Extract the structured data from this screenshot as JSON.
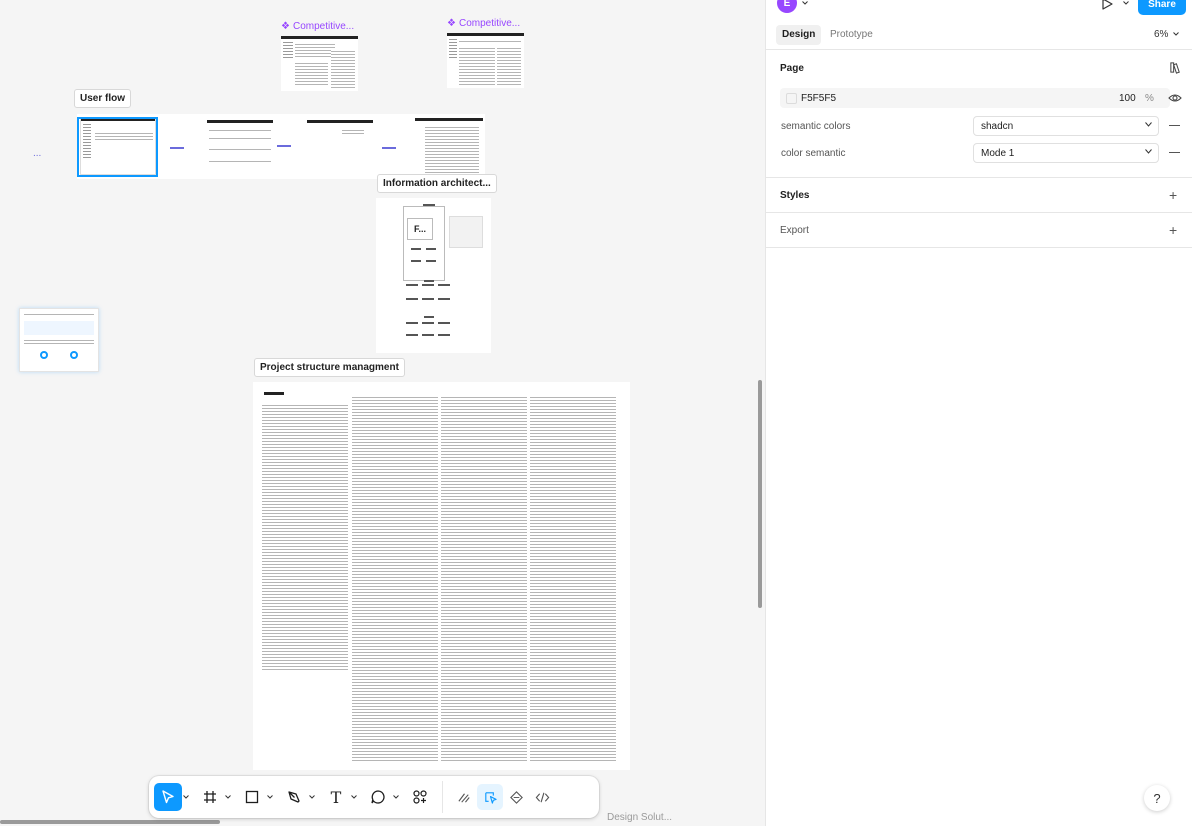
{
  "canvas": {
    "component_labels": [
      {
        "id": "comp-1",
        "text": "Competitive..."
      },
      {
        "id": "comp-2",
        "text": "Competitive..."
      }
    ],
    "frame_labels": {
      "user_flow": "User flow",
      "information_architecture": "Information architect...",
      "project_structure": "Project structure managment"
    },
    "node_text": "F...",
    "page_name_hint": "Design Solut...",
    "ellipsis": "..."
  },
  "toolbar": {
    "tools": [
      {
        "name": "move-tool",
        "icon": "cursor-arrow-icon",
        "active": true
      },
      {
        "name": "frame-tool",
        "icon": "hash-frame-icon",
        "active": false
      },
      {
        "name": "rectangle-tool",
        "icon": "rectangle-icon",
        "active": false
      },
      {
        "name": "pen-tool",
        "icon": "pen-icon",
        "active": false
      },
      {
        "name": "text-tool",
        "icon": "text-t-icon",
        "active": false
      },
      {
        "name": "comment-tool",
        "icon": "comment-bubble-icon",
        "active": false
      },
      {
        "name": "actions-tool",
        "icon": "actions-plus-icon",
        "active": false
      }
    ],
    "mode_tools": [
      {
        "name": "draw-mode",
        "icon": "draw-squiggle-icon",
        "active": false
      },
      {
        "name": "design-mode",
        "icon": "design-cursor-icon",
        "active": true
      },
      {
        "name": "components-mode",
        "icon": "component-diamond-icon",
        "active": false
      },
      {
        "name": "dev-mode",
        "icon": "code-brackets-icon",
        "active": false
      }
    ],
    "text_glyph": "T"
  },
  "panel": {
    "avatar_letter": "E",
    "share_label": "Share",
    "tabs": [
      {
        "label": "Design",
        "active": true
      },
      {
        "label": "Prototype",
        "active": false
      }
    ],
    "zoom": "6%",
    "page_section": {
      "title": "Page",
      "background_hex": "F5F5F5",
      "opacity": "100",
      "percent": "%"
    },
    "variables": [
      {
        "label": "semantic colors",
        "value": "shadcn"
      },
      {
        "label": "color semantic",
        "value": "Mode 1"
      }
    ],
    "styles_title": "Styles",
    "export_title": "Export",
    "help": "?"
  },
  "colors": {
    "accent": "#0d99ff",
    "component": "#9747ff",
    "canvas": "#f5f5f5"
  }
}
